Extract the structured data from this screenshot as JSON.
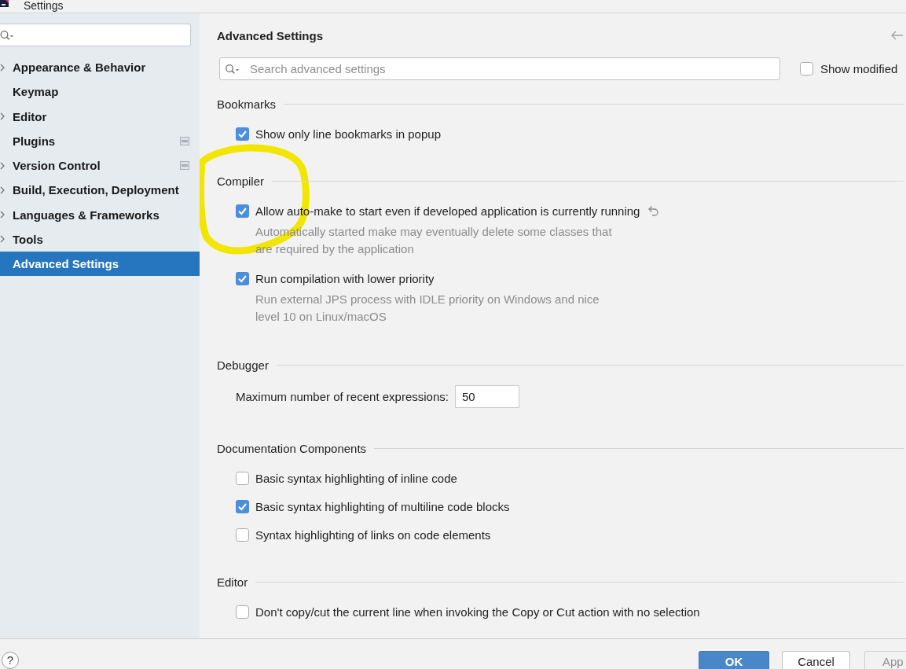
{
  "window": {
    "title": "Settings"
  },
  "sidebar": {
    "items": [
      {
        "label": "Appearance & Behavior",
        "kind": "group",
        "selected": false,
        "side_icon": false
      },
      {
        "label": "Keymap",
        "kind": "page",
        "selected": false,
        "side_icon": false
      },
      {
        "label": "Editor",
        "kind": "group",
        "selected": false,
        "side_icon": false
      },
      {
        "label": "Plugins",
        "kind": "page",
        "selected": false,
        "side_icon": true
      },
      {
        "label": "Version Control",
        "kind": "group",
        "selected": false,
        "side_icon": true
      },
      {
        "label": "Build, Execution, Deployment",
        "kind": "group",
        "selected": false,
        "side_icon": false
      },
      {
        "label": "Languages & Frameworks",
        "kind": "group",
        "selected": false,
        "side_icon": false
      },
      {
        "label": "Tools",
        "kind": "group",
        "selected": false,
        "side_icon": false
      },
      {
        "label": "Advanced Settings",
        "kind": "page",
        "selected": true,
        "side_icon": false
      }
    ]
  },
  "panel": {
    "title": "Advanced Settings",
    "search": {
      "placeholder": "Search advanced settings"
    },
    "show_modified": {
      "label": "Show modified",
      "checked": false
    },
    "sections": [
      {
        "title": "Bookmarks",
        "items": [
          {
            "kind": "checkbox",
            "label": "Show only line bookmarks in popup",
            "checked": true,
            "modified": false
          }
        ]
      },
      {
        "title": "Compiler",
        "items": [
          {
            "kind": "checkbox",
            "label": "Allow auto-make to start even if developed application is currently running",
            "checked": true,
            "modified": true,
            "description": "Automatically started make may eventually delete some classes that\nare required by the application"
          },
          {
            "kind": "checkbox",
            "label": "Run compilation with lower priority",
            "checked": true,
            "modified": false,
            "description": "Run external JPS process with IDLE priority on Windows and nice\nlevel 10 on Linux/macOS"
          }
        ]
      },
      {
        "title": "Debugger",
        "items": [
          {
            "kind": "number",
            "label": "Maximum number of recent expressions:",
            "value": "50"
          }
        ]
      },
      {
        "title": "Documentation Components",
        "items": [
          {
            "kind": "checkbox",
            "label": "Basic syntax highlighting of inline code",
            "checked": false,
            "modified": false
          },
          {
            "kind": "checkbox",
            "label": "Basic syntax highlighting of multiline code blocks",
            "checked": true,
            "modified": false
          },
          {
            "kind": "checkbox",
            "label": "Syntax highlighting of links on code elements",
            "checked": false,
            "modified": false
          }
        ]
      },
      {
        "title": "Editor",
        "items": [
          {
            "kind": "checkbox",
            "label": "Don't copy/cut the current line when invoking the Copy or Cut action with no selection",
            "checked": false,
            "modified": false
          }
        ]
      }
    ]
  },
  "help_button": {
    "label": "?"
  },
  "buttons": [
    {
      "label": "OK",
      "kind": "default",
      "disabled": false
    },
    {
      "label": "Cancel",
      "kind": "normal",
      "disabled": false
    },
    {
      "label": "App",
      "kind": "normal",
      "disabled": true
    }
  ]
}
